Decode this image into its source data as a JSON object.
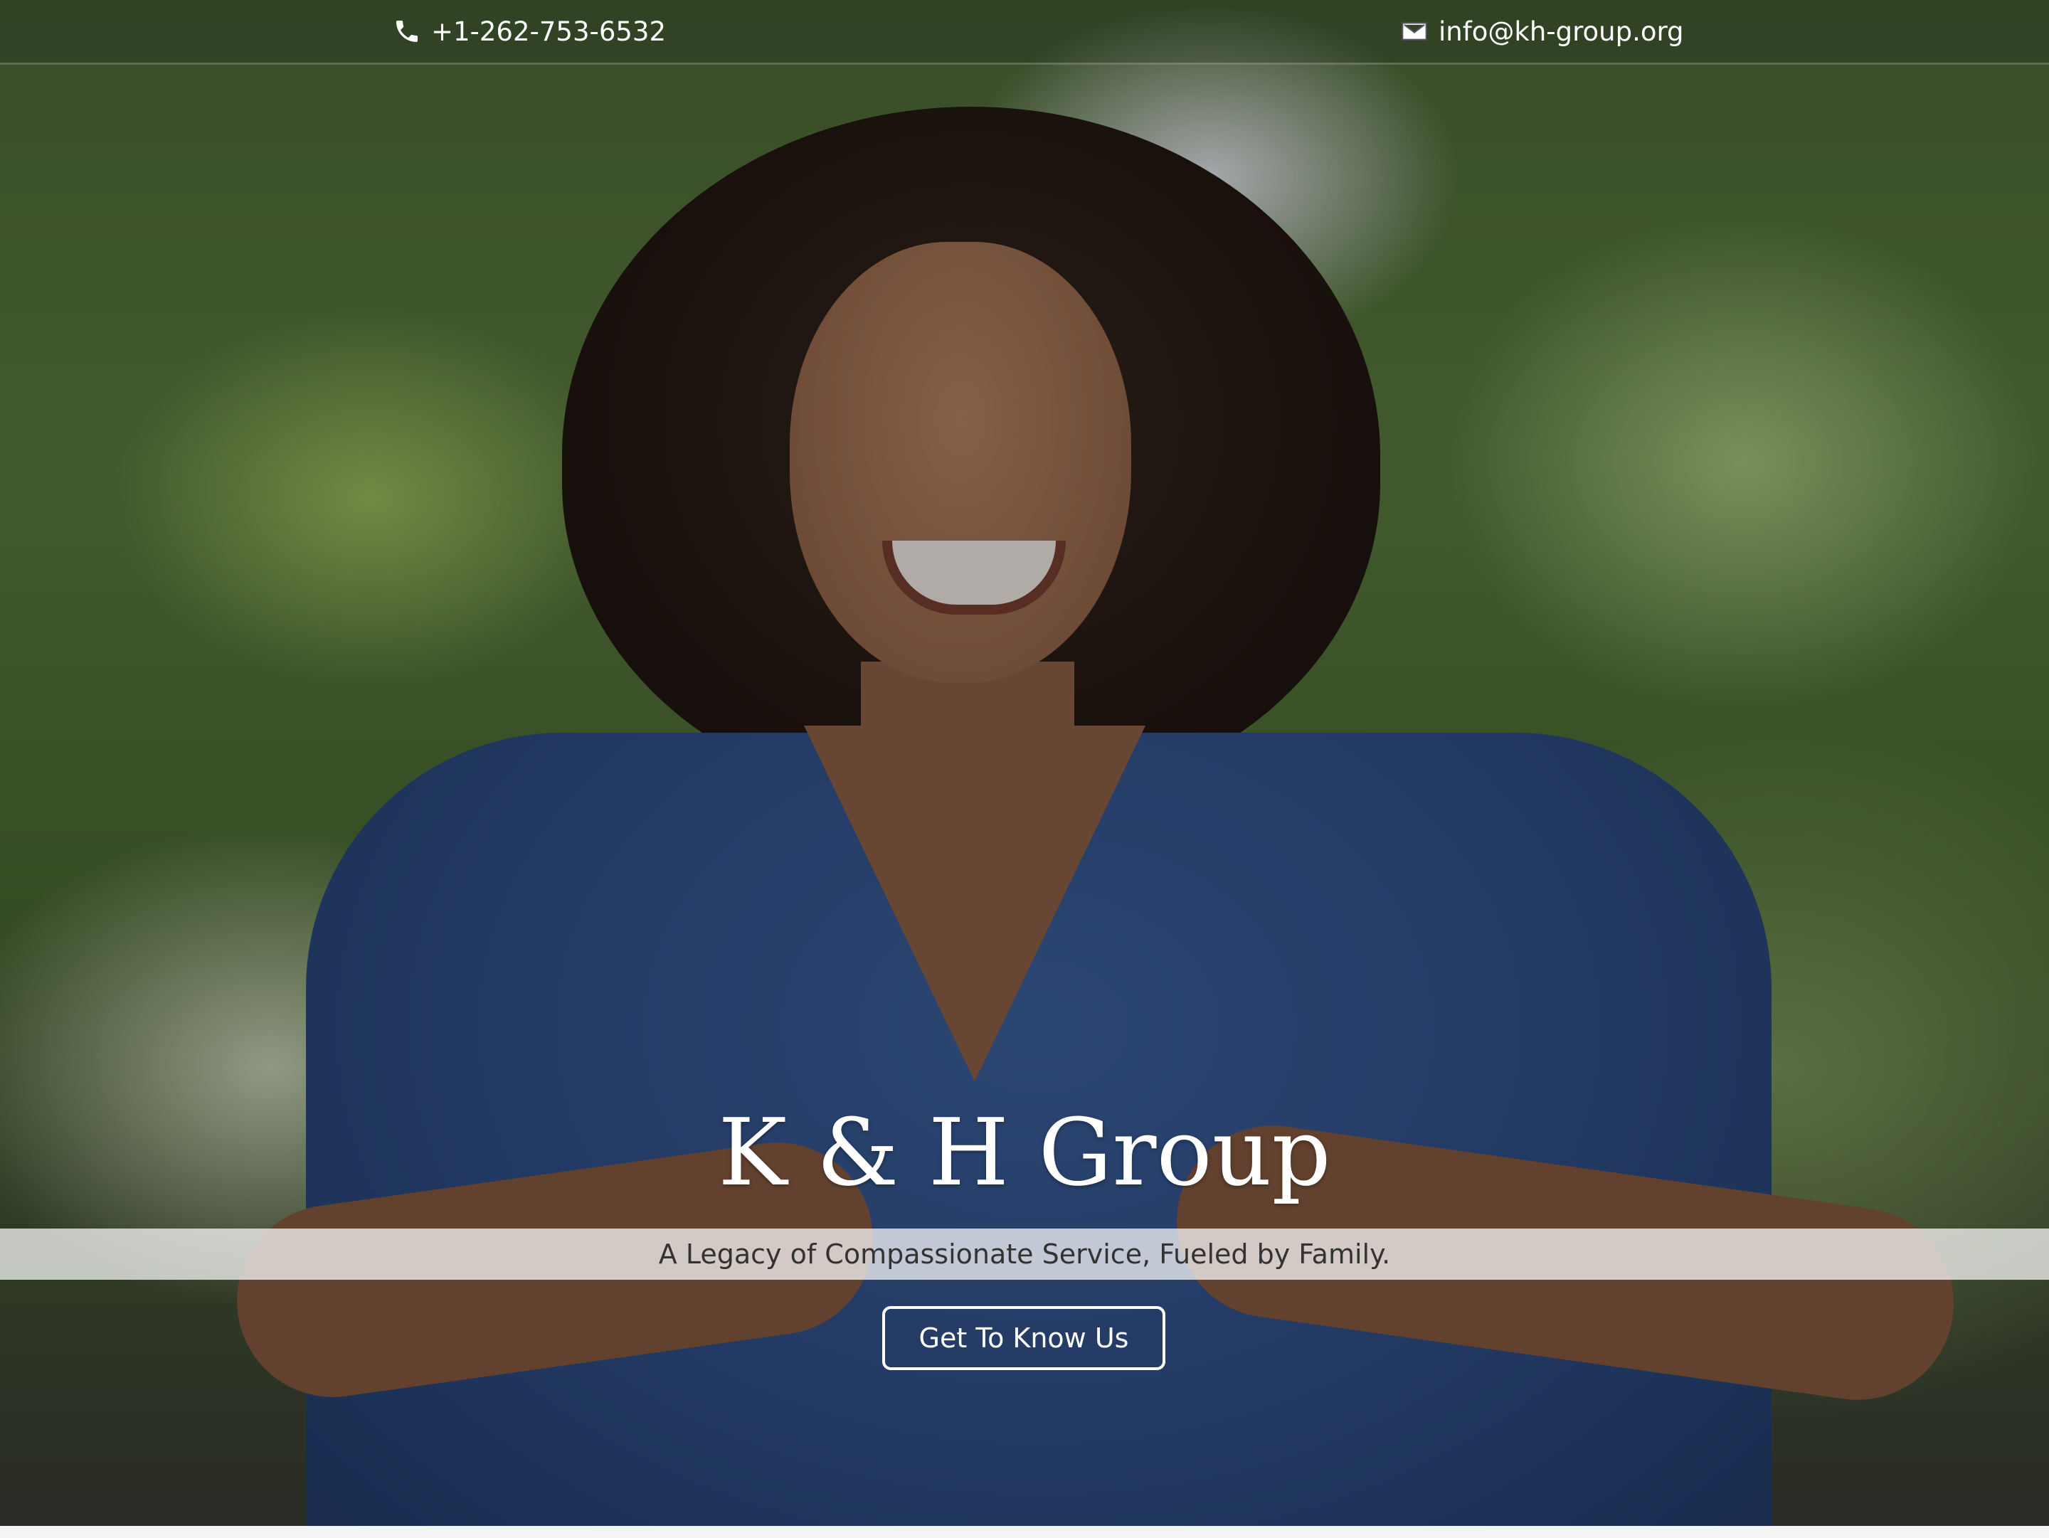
{
  "contact_bar": {
    "phone": {
      "icon": "phone-icon",
      "text": "+1-262-753-6532"
    },
    "email": {
      "icon": "envelope-icon",
      "text": "info@kh-group.org"
    }
  },
  "hero": {
    "title": "K & H Group",
    "tagline": "A Legacy of Compassionate Service, Fueled by Family.",
    "cta_label": "Get To Know Us",
    "image_alt_subject": "smiling woman in blue scrubs making a heart shape with her hands in a garden"
  },
  "colors": {
    "text_light": "#ffffff",
    "tagline_text": "#333333",
    "scrub_blue": "#2f4f88",
    "foliage_green": "#5b7d3f"
  }
}
